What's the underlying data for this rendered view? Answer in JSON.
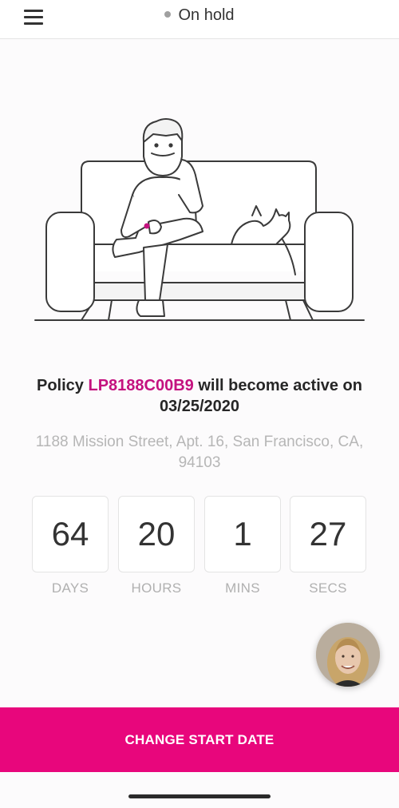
{
  "header": {
    "status_label": "On hold",
    "status_dot_color": "#a0a0a0",
    "menu_icon": "hamburger-menu-icon"
  },
  "illustration": {
    "description_icon": "man-on-couch-with-cat-illustration"
  },
  "policy": {
    "prefix": "Policy",
    "policy_id": "LP8188C00B9",
    "suffix": "will become active on",
    "date": "03/25/2020",
    "highlight_color": "#c4127f"
  },
  "address": {
    "text": "1188 Mission Street, Apt. 16, San Francisco, CA, 94103"
  },
  "countdown": [
    {
      "value": "64",
      "label": "DAYS"
    },
    {
      "value": "20",
      "label": "HOURS"
    },
    {
      "value": "1",
      "label": "MINS"
    },
    {
      "value": "27",
      "label": "SECS"
    }
  ],
  "support": {
    "avatar_icon": "support-agent-avatar"
  },
  "cta": {
    "label": "CHANGE START DATE",
    "color": "#e8067c"
  }
}
